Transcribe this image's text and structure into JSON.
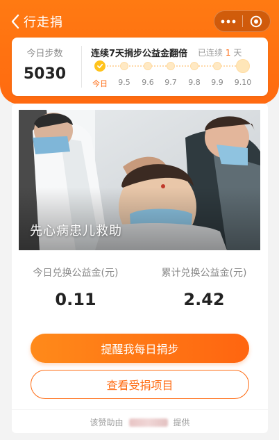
{
  "nav": {
    "title": "行走捐"
  },
  "steps": {
    "today_label": "今日步数",
    "today_value": "5030"
  },
  "streak": {
    "title": "连续7天捐步公益金翻倍",
    "sub_prefix": "已连续",
    "days": "1",
    "sub_suffix": "天",
    "days_labels": [
      "今日",
      "9.5",
      "9.6",
      "9.7",
      "9.8",
      "9.9",
      "9.10"
    ]
  },
  "project": {
    "caption": "先心病患儿救助"
  },
  "stats": {
    "today_label": "今日兑换公益金(元)",
    "today_value": "0.11",
    "total_label": "累计兑换公益金(元)",
    "total_value": "2.42"
  },
  "buttons": {
    "remind": "提醒我每日捐步",
    "view_projects": "查看受捐项目"
  },
  "footer": {
    "prefix": "该赞助由",
    "suffix": "提供"
  },
  "colors": {
    "brand_orange": "#ff6a10",
    "header_orange": "#ff7a12",
    "check_yellow": "#ffc31c"
  }
}
